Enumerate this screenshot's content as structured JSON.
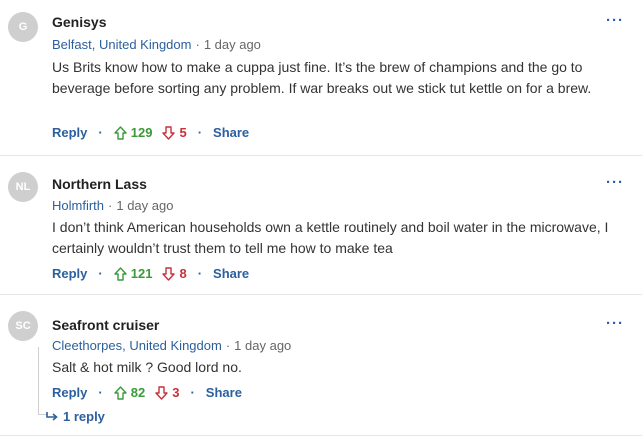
{
  "comments": [
    {
      "initials": "G",
      "author": "Genisys",
      "location": "Belfast, United Kingdom",
      "sep": "·",
      "time": "1 day ago",
      "text": "Us Brits know how to make a cuppa just fine. It’s the brew of champions and the go to beverage before sorting any problem. If war breaks out we stick tut kettle on for a brew.",
      "reply_label": "Reply",
      "upvotes": "129",
      "downvotes": "5",
      "share_label": "Share",
      "more": "···"
    },
    {
      "initials": "NL",
      "author": "Northern Lass",
      "location": "Holmfirth",
      "sep": "·",
      "time": "1 day ago",
      "text": "I don’t think American households own a kettle routinely and boil water in the microwave, I certainly wouldn’t trust them to tell me how to make tea",
      "reply_label": "Reply",
      "upvotes": "121",
      "downvotes": "8",
      "share_label": "Share",
      "more": "···"
    },
    {
      "initials": "SC",
      "author": "Seafront cruiser",
      "location": "Cleethorpes, United Kingdom",
      "sep": "·",
      "time": "1 day ago",
      "text": "Salt & hot milk ? Good lord no.",
      "reply_label": "Reply",
      "upvotes": "82",
      "downvotes": "3",
      "share_label": "Share",
      "more": "···",
      "replies_label": "1 reply"
    }
  ],
  "action_dot": "·",
  "colors": {
    "link": "#2b5f9e",
    "upvote": "#3a9a3a",
    "downvote": "#c8303c",
    "avatar_bg": "#cfcfcf"
  },
  "icons": [
    "arrow-up-icon",
    "arrow-down-icon",
    "more-options-icon",
    "reply-arrow-icon"
  ]
}
